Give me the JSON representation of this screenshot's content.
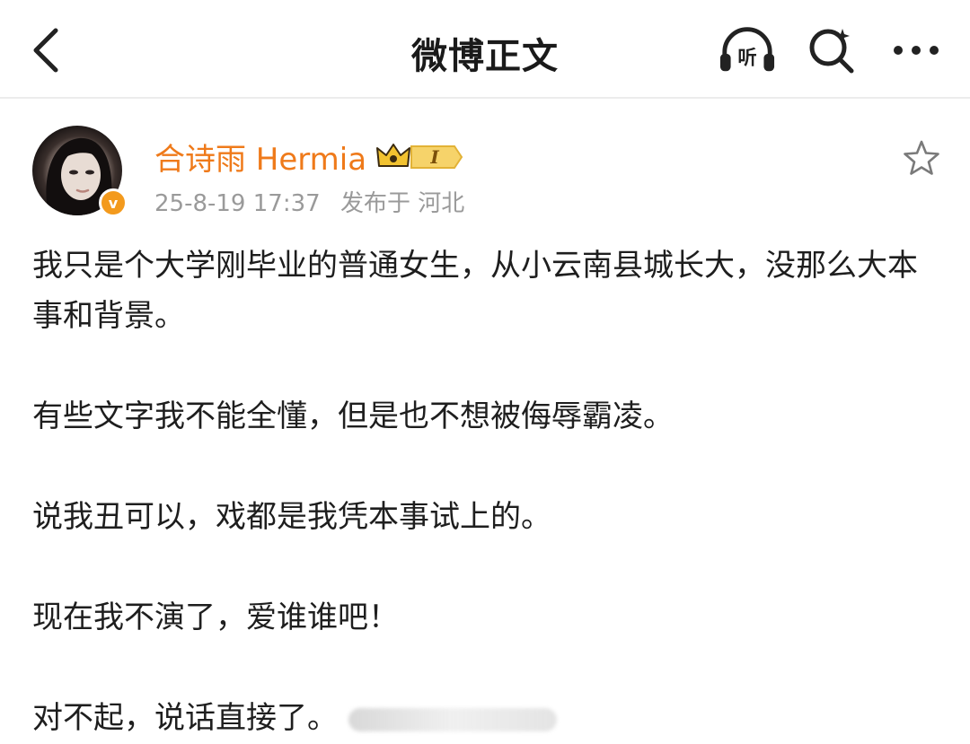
{
  "header": {
    "title": "微博正文",
    "listen_label": "听"
  },
  "post": {
    "author": {
      "name": "合诗雨 Hermia",
      "verified_mark": "v",
      "vip_level": "I"
    },
    "meta": {
      "date": "25-8-19 17:37",
      "location": "发布于 河北"
    },
    "paragraphs": [
      "我只是个大学刚毕业的普通女生，从小云南县城长大，没那么大本事和背景。",
      "有些文字我不能全懂，但是也不想被侮辱霸凌。",
      "说我丑可以，戏都是我凭本事试上的。",
      "现在我不演了，爱谁谁吧！",
      "对不起，说话直接了。"
    ]
  },
  "colors": {
    "username": "#ef7a1a",
    "verified_badge": "#f39a1d",
    "meta_text": "#9a9a9a",
    "crown_gold": "#f2c230"
  },
  "icons": {
    "back": "chevron-left-icon",
    "listen": "headphones-icon",
    "search": "search-icon",
    "more": "more-dots-icon",
    "favorite": "star-outline-icon",
    "vip": "crown-icon"
  }
}
